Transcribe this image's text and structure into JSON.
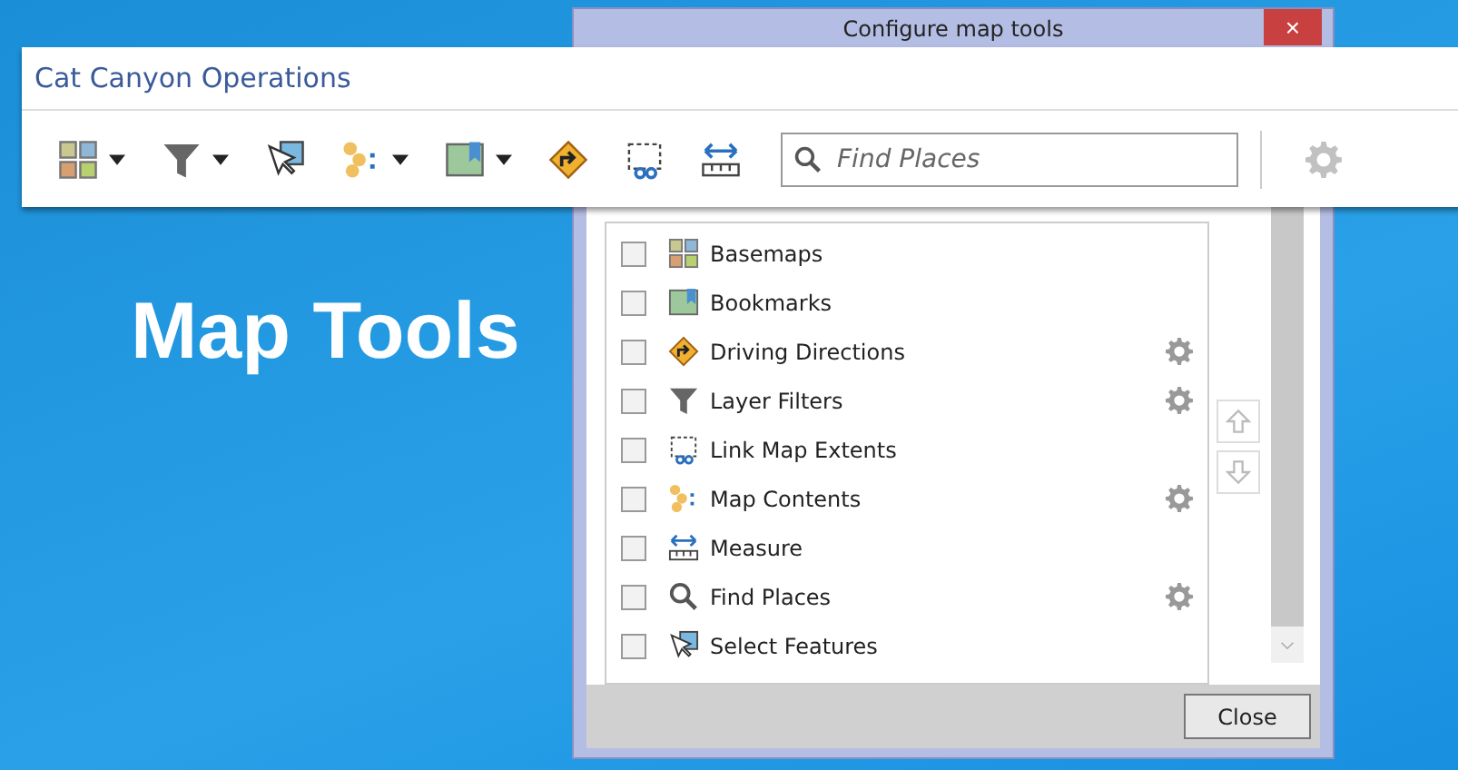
{
  "headline": "Map Tools",
  "dialog": {
    "title": "Configure map tools",
    "close_button": "×",
    "tools": [
      {
        "kind": "basemaps",
        "label": "Basemaps",
        "checked": false,
        "has_settings": false
      },
      {
        "kind": "bookmarks",
        "label": "Bookmarks",
        "checked": false,
        "has_settings": false
      },
      {
        "kind": "directions",
        "label": "Driving Directions",
        "checked": false,
        "has_settings": true
      },
      {
        "kind": "filter",
        "label": "Layer Filters",
        "checked": false,
        "has_settings": true
      },
      {
        "kind": "link",
        "label": "Link Map Extents",
        "checked": false,
        "has_settings": false
      },
      {
        "kind": "contents",
        "label": "Map Contents",
        "checked": false,
        "has_settings": true
      },
      {
        "kind": "measure",
        "label": "Measure",
        "checked": false,
        "has_settings": false
      },
      {
        "kind": "search",
        "label": "Find Places",
        "checked": false,
        "has_settings": true
      },
      {
        "kind": "select",
        "label": "Select Features",
        "checked": false,
        "has_settings": false
      }
    ],
    "buttons": [
      "Close"
    ]
  },
  "app": {
    "title": "Cat Canyon Operations",
    "toolbar": [
      {
        "kind": "basemaps",
        "has_dropdown": true
      },
      {
        "kind": "filter",
        "has_dropdown": true
      },
      {
        "kind": "select",
        "has_dropdown": false
      },
      {
        "kind": "contents",
        "has_dropdown": true
      },
      {
        "kind": "bookmarks",
        "has_dropdown": true
      },
      {
        "kind": "directions",
        "has_dropdown": false
      },
      {
        "kind": "link",
        "has_dropdown": false
      },
      {
        "kind": "measure",
        "has_dropdown": false
      }
    ],
    "search": {
      "placeholder": "Find Places"
    },
    "settings_disabled": true
  }
}
